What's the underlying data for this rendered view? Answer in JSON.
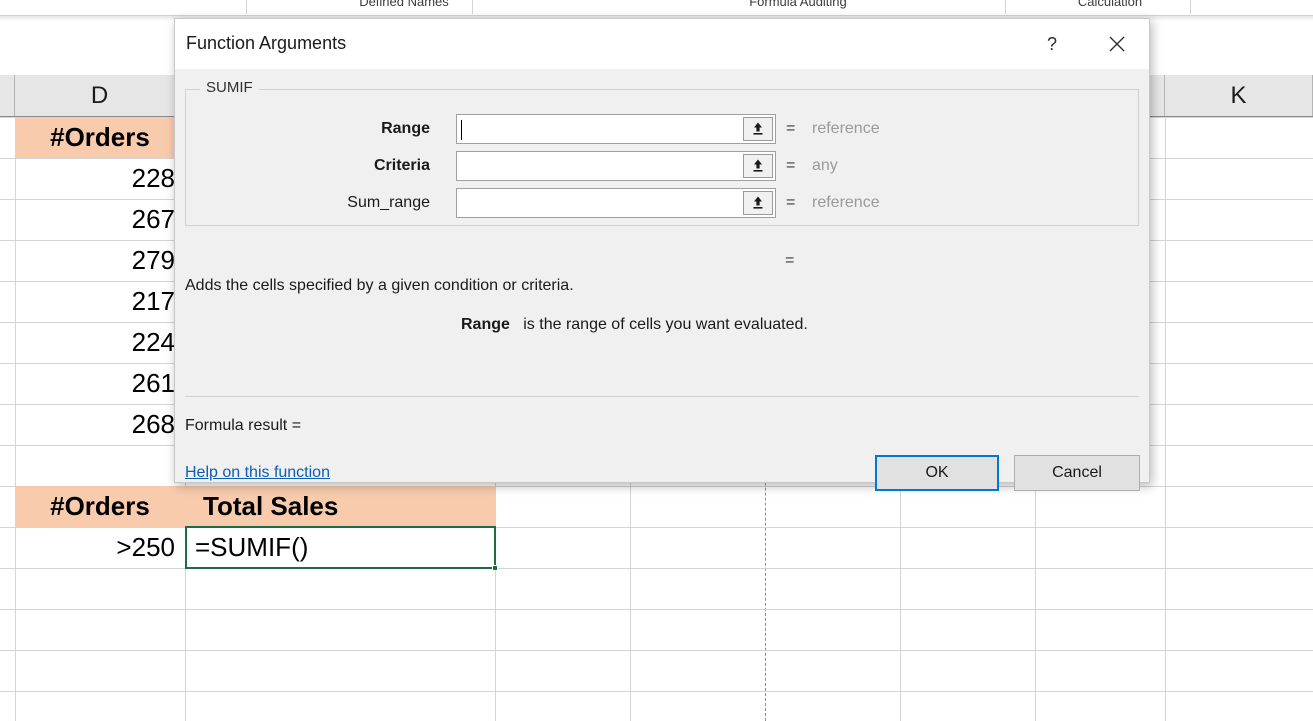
{
  "ribbon": {
    "groups": [
      {
        "label": "Defined Names"
      },
      {
        "label": "Formula Auditing"
      },
      {
        "label": "Calculation"
      }
    ]
  },
  "sheet": {
    "columns": [
      {
        "label": "D"
      },
      {
        "label": "K"
      }
    ],
    "upper_table": {
      "header": "#Orders",
      "values": [
        "228",
        "267",
        "279",
        "217",
        "224",
        "261",
        "268"
      ]
    },
    "lower_table": {
      "header_orders": "#Orders",
      "header_total_sales": "Total Sales",
      "criteria_value": ">250",
      "active_cell_formula": "=SUMIF()"
    }
  },
  "dialog": {
    "title": "Function Arguments",
    "help_icon": "question-mark-icon",
    "close_icon": "close-icon",
    "group_label": "SUMIF",
    "picker_icon": "range-selector-icon",
    "equals": "=",
    "arguments": [
      {
        "label": "Range",
        "required": true,
        "value": "",
        "type": "reference"
      },
      {
        "label": "Criteria",
        "required": true,
        "value": "",
        "type": "any"
      },
      {
        "label": "Sum_range",
        "required": false,
        "value": "",
        "type": "reference"
      }
    ],
    "result_equals": "=",
    "description": "Adds the cells specified by a given condition or criteria.",
    "argument_help_name": "Range",
    "argument_help_text": "is the range of cells you want evaluated.",
    "formula_result_label": "Formula result =",
    "help_link": "Help on this function",
    "ok_label": "OK",
    "cancel_label": "Cancel"
  },
  "colors": {
    "header_fill": "#F8CBAD",
    "active_cell_border": "#1E6C41",
    "focus_border": "#0078D7",
    "link": "#0A5FB5"
  }
}
